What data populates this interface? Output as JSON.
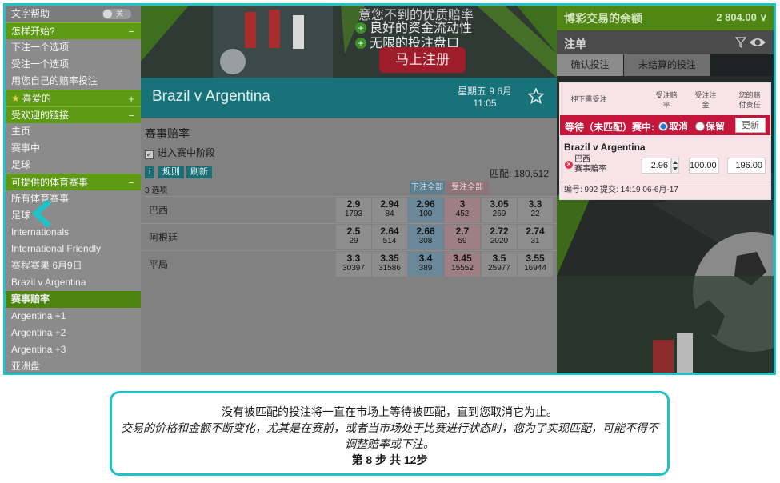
{
  "sidebar": {
    "text_help": "文字帮助",
    "toggle_state": "关",
    "how_start": "怎样开始?",
    "items_start": [
      "下注一个选项",
      "受注一个选项",
      "用您自己的赔率投注"
    ],
    "favorites": "喜爱的",
    "popular_links": "受欢迎的链接",
    "items_popular": [
      "主页",
      "赛事中",
      "足球"
    ],
    "available_events": "可提供的体育赛事",
    "items_events": [
      "所有体育赛事",
      "足球",
      "Internationals",
      "International Friendly",
      "赛程赛果 6月9日",
      "Brazil v Argentina"
    ],
    "current_market": "赛事赔率",
    "items_markets": [
      "Argentina +1",
      "Argentina +2",
      "Argentina +3",
      "亚洲盘"
    ]
  },
  "banner": {
    "line1": "意您不到的优质赔率",
    "line2": "良好的资金流动性",
    "line3": "无限的投注盘口",
    "cta": "马上注册"
  },
  "event": {
    "title": "Brazil v Argentina",
    "day": "星期五 9 6月",
    "time": "11:05"
  },
  "market": {
    "title": "赛事赔率",
    "inplay_label": "进入赛中阶段",
    "rules_btn": "规则",
    "refresh_btn": "刷新",
    "info_btn": "i",
    "matched": "匹配: 180,512",
    "selections": "3 选项",
    "back_all": "下注全部",
    "lay_all": "受注全部",
    "runners": [
      {
        "name": "巴西",
        "prices": [
          [
            "2.9",
            "1793"
          ],
          [
            "2.94",
            "84"
          ],
          [
            "2.96",
            "100"
          ],
          [
            "3",
            "452"
          ],
          [
            "3.05",
            "269"
          ],
          [
            "3.3",
            "22"
          ]
        ]
      },
      {
        "name": "阿根廷",
        "prices": [
          [
            "2.5",
            "29"
          ],
          [
            "2.64",
            "514"
          ],
          [
            "2.66",
            "308"
          ],
          [
            "2.7",
            "59"
          ],
          [
            "2.72",
            "2020"
          ],
          [
            "2.74",
            "31"
          ]
        ]
      },
      {
        "name": "平局",
        "prices": [
          [
            "3.3",
            "30397"
          ],
          [
            "3.35",
            "31586"
          ],
          [
            "3.4",
            "389"
          ],
          [
            "3.45",
            "15552"
          ],
          [
            "3.5",
            "25977"
          ],
          [
            "3.55",
            "16944"
          ]
        ]
      }
    ]
  },
  "right": {
    "title": "博彩交易的余额",
    "balance": "2 804.00",
    "balance_caret": "∨",
    "betslip": "注单",
    "tab_confirm": "确认投注",
    "tab_unsettled": "未结算的投注",
    "col_lay_unmatched": "押下熏受注",
    "col_odds": "受注赔率",
    "col_stake": "受注注金",
    "col_liability": "您的赔付责任",
    "waiting": "等待（未匹配）赛中:",
    "opt_cancel": "取消",
    "opt_keep": "保留",
    "update": "更新",
    "bet_event": "Brazil v Argentina",
    "bet_runner": "巴西",
    "bet_market": "赛事赔率",
    "bet_odds": "2.96",
    "bet_stake": "100.00",
    "bet_liability": "196.00",
    "bet_ref": "编号: 992 提交: 14:19 06-6月-17"
  },
  "caption": {
    "line1": "没有被匹配的投注将一直在市场上等待被匹配，直到您取消它为止。",
    "line2": "交易的价格和金额不断变化，尤其是在赛前，或者当市场处于比赛进行状态时，您为了实现匹配，可能不得不调整赔率或下注。",
    "step_prefix": "第",
    "step_current": "8",
    "step_mid": "步 共",
    "step_total": "12",
    "step_suffix": "步"
  },
  "colors": {
    "accent_cyan": "#1ec3c9",
    "sidebar_green": "#5e9a14",
    "event_teal": "#17727a",
    "waiting_red": "#c4153a"
  }
}
